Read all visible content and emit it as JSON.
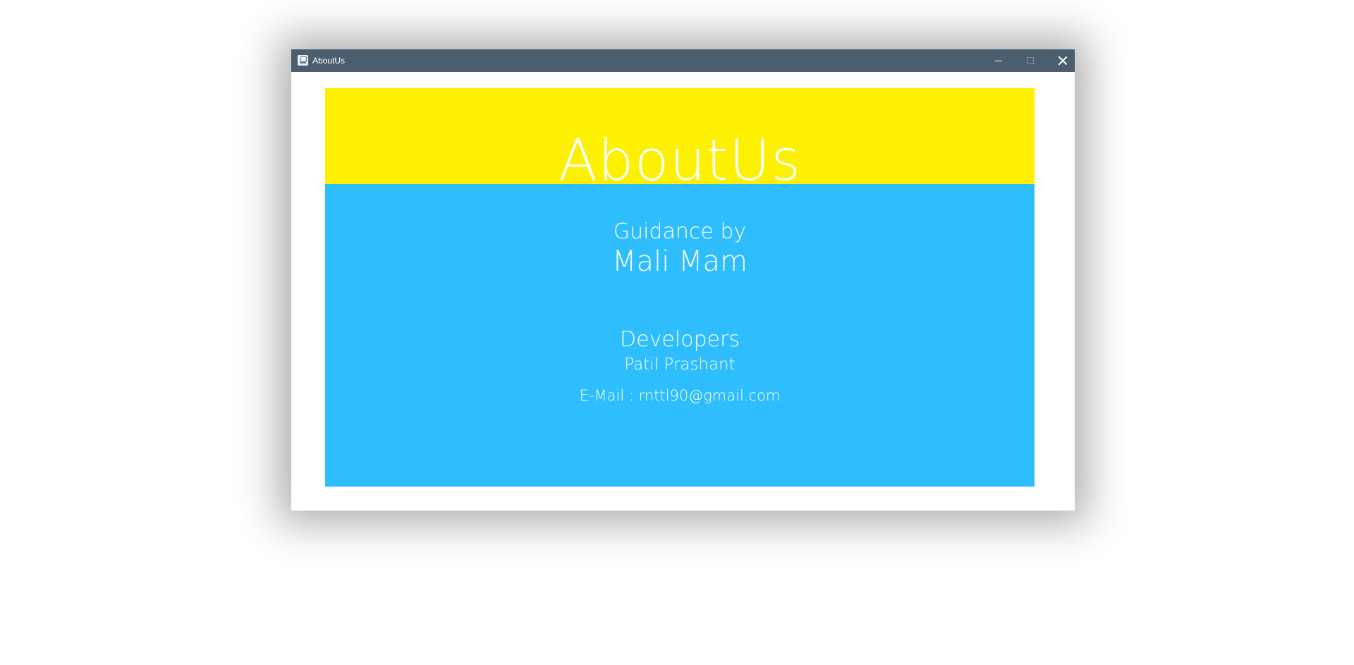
{
  "window": {
    "title": "AboutUs",
    "controls": {
      "minimize": "minimize-icon",
      "maximize": "maximize-icon",
      "close": "close-icon"
    }
  },
  "about": {
    "title": "AboutUs",
    "guidance_label": "Guidance by",
    "guidance_name": "Mali Mam",
    "developers_label": "Developers",
    "developer_name": "Patil Prashant",
    "developer_email": "E-Mail : rnttl90@gmail.com"
  },
  "colors": {
    "titlebar": "#4a5e70",
    "header_band": "#fdf000",
    "body_panel": "#2fbefd",
    "text": "#ffffff"
  }
}
